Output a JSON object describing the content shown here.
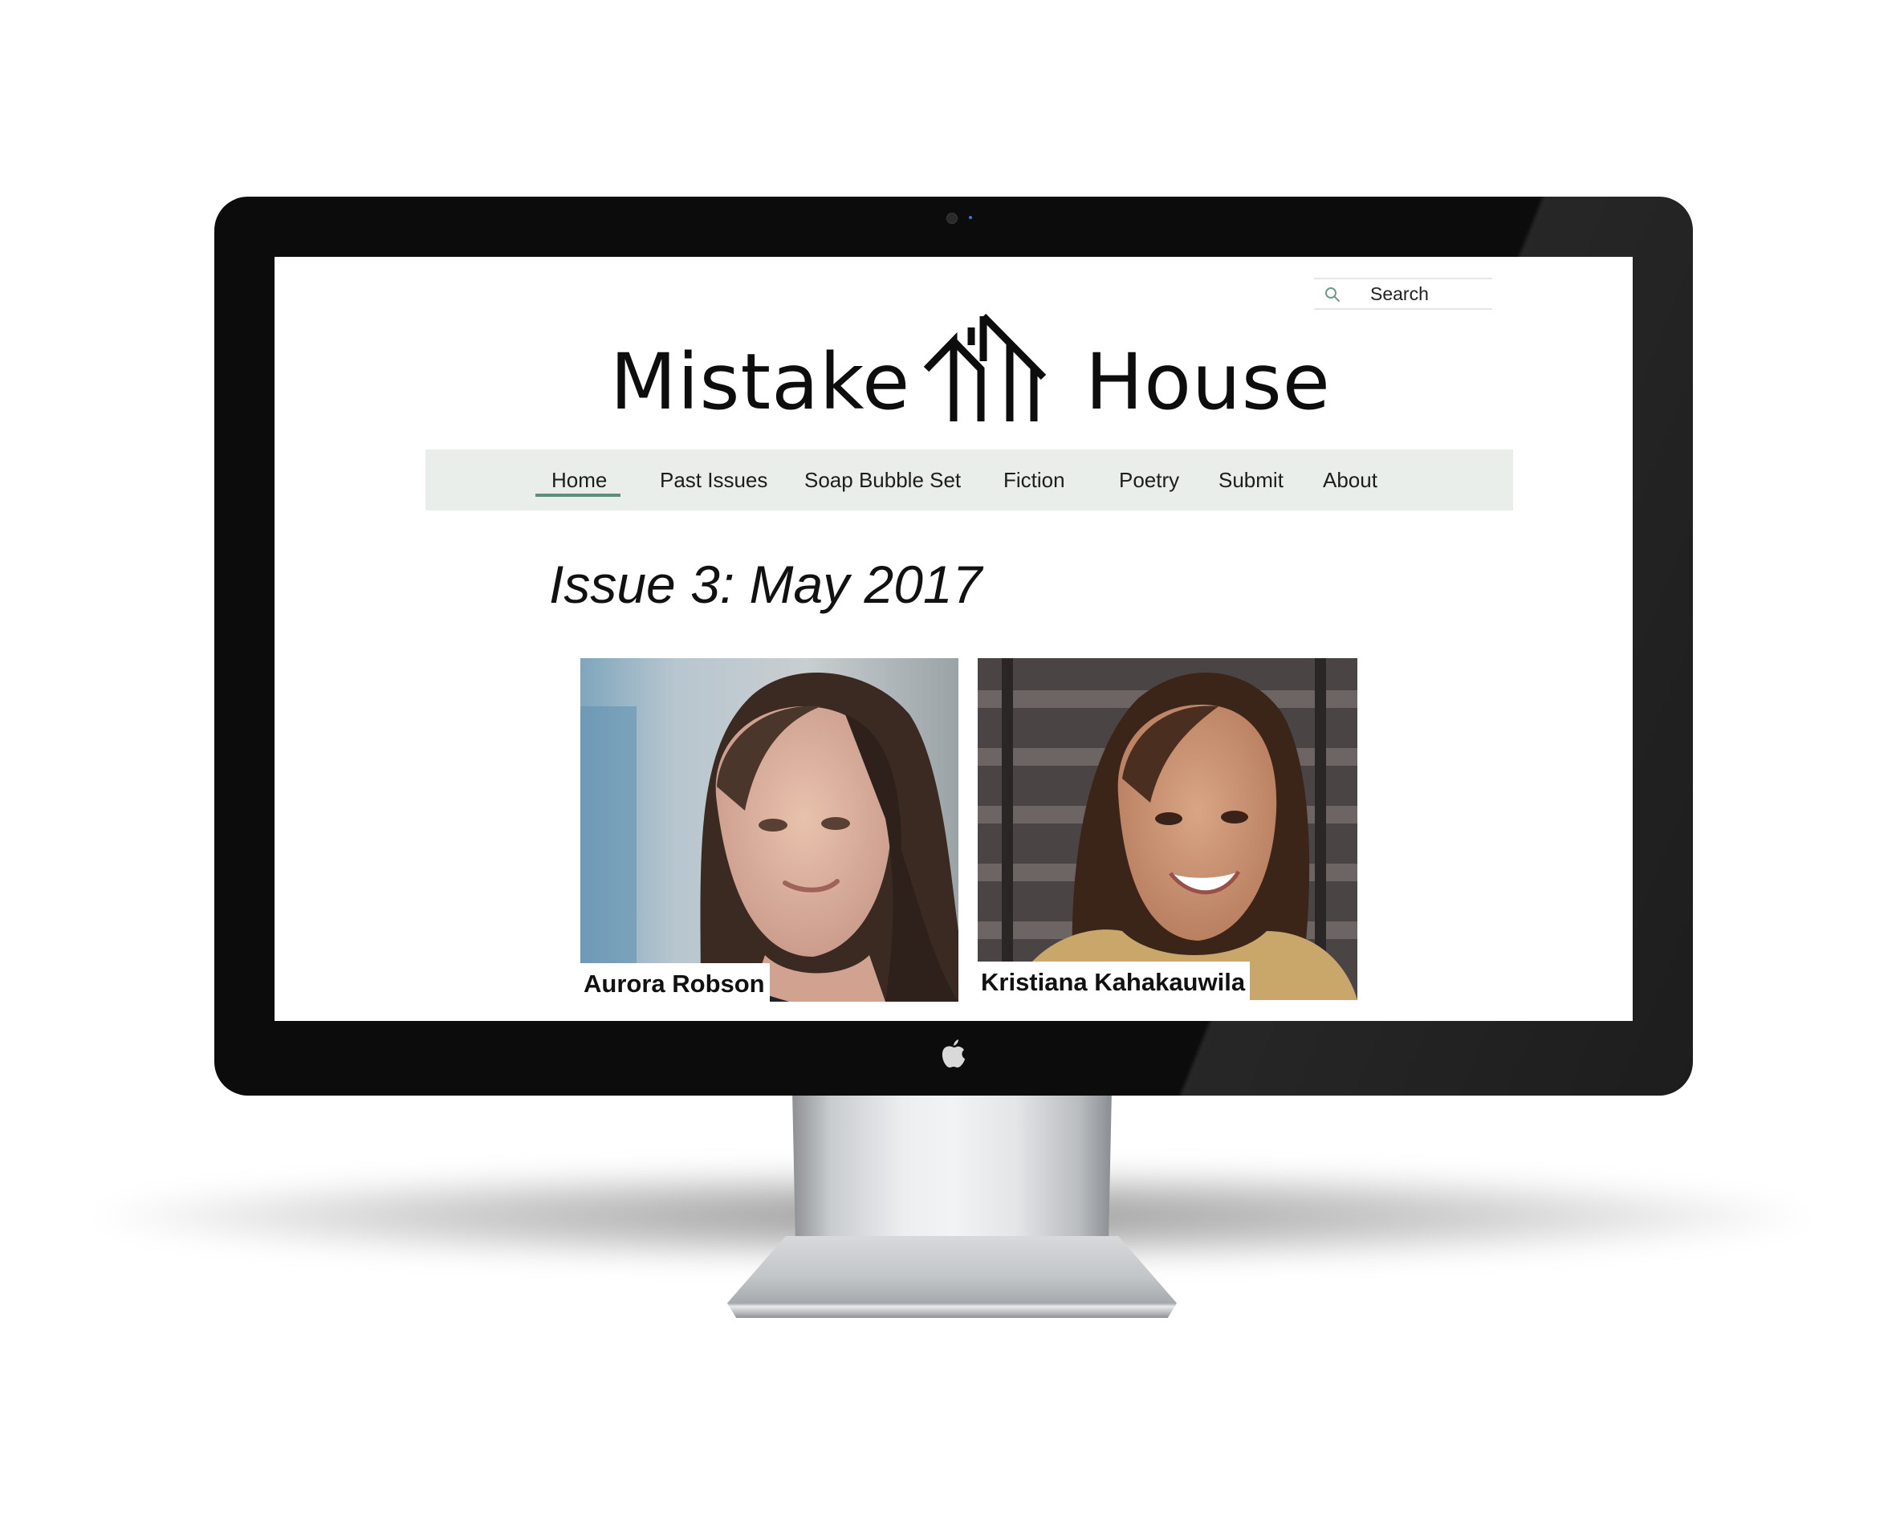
{
  "search": {
    "placeholder": "Search",
    "icon": "search-icon"
  },
  "logo": {
    "left_text": "Mistake",
    "right_text": "House",
    "icon": "house-lines-logo-icon"
  },
  "nav": {
    "items": [
      "Home",
      "Past Issues",
      "Soap Bubble Set",
      "Fiction",
      "Poetry",
      "Submit",
      "About"
    ],
    "active": "Home"
  },
  "issue": {
    "title": "Issue 3: May 2017"
  },
  "contributors": [
    {
      "name": "Aurora Robson"
    },
    {
      "name": "Kristiana Kahakauwila"
    }
  ],
  "colors": {
    "nav_background": "#e9eeea",
    "active_underline": "#5f8f7a",
    "search_icon": "#6d9c86"
  }
}
